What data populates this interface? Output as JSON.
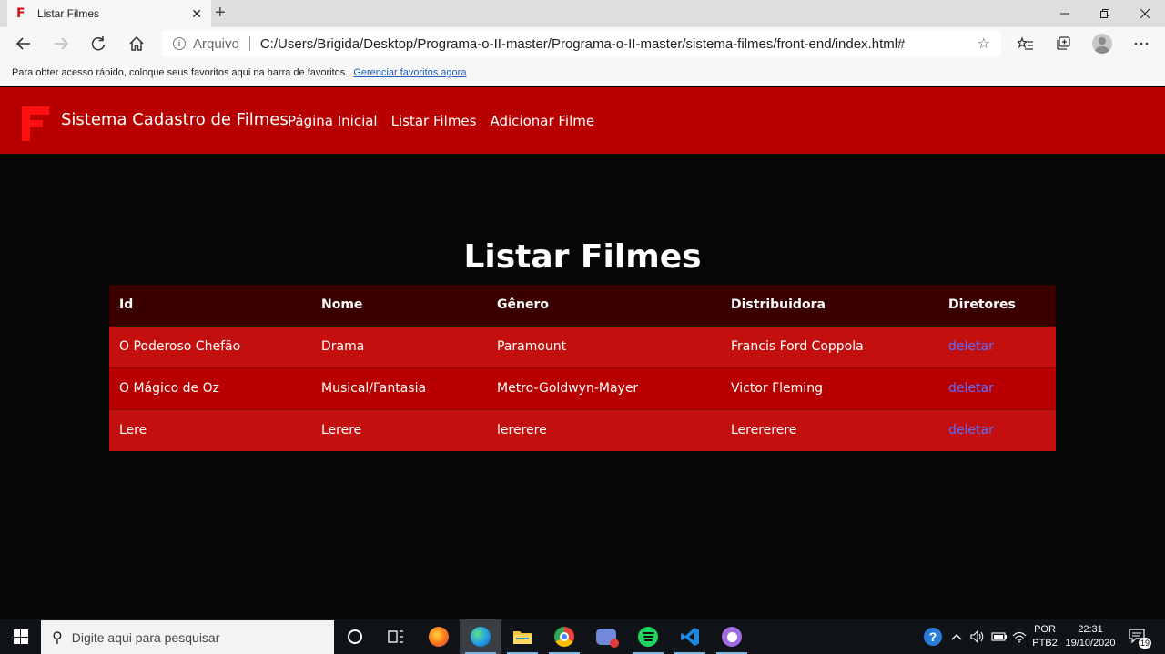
{
  "browser": {
    "tab_title": "Listar Filmes",
    "tab_favicon": "F",
    "close_tab": "✕",
    "new_tab": "+",
    "origin_label": "Arquivo",
    "url": "C:/Users/Brigida/Desktop/Programa-o-II-master/Programa-o-II-master/sistema-filmes/front-end/index.html#",
    "favorites_message": "Para obter acesso rápido, coloque seus favoritos aqui na barra de favoritos.",
    "favorites_link": "Gerenciar favoritos agora",
    "icons": [
      "back-icon",
      "forward-icon",
      "refresh-icon",
      "home-icon",
      "info-icon",
      "star-icon",
      "favorites-icon",
      "collections-icon",
      "profile-icon",
      "more-icon",
      "minimize-icon",
      "maximize-icon",
      "close-icon"
    ]
  },
  "site": {
    "logo": "F",
    "brand": "Sistema Cadastro de Filmes",
    "nav": [
      "Página Inicial",
      "Listar Filmes",
      "Adicionar Filme"
    ],
    "colors": {
      "header": "#b80000",
      "table_head": "#3a0000",
      "link": "#5a6dff"
    }
  },
  "main": {
    "title": "Listar Filmes",
    "columns": [
      "Id",
      "Nome",
      "Gênero",
      "Distribuidora",
      "Diretores"
    ],
    "rows": [
      [
        "O Poderoso Chefão",
        "Drama",
        "Paramount",
        "Francis Ford Coppola",
        "deletar"
      ],
      [
        "O Mágico de Oz",
        "Musical/Fantasia",
        "Metro-Goldwyn-Mayer",
        "Victor Fleming",
        "deletar"
      ],
      [
        "Lere",
        "Lerere",
        "lererere",
        "Lerererere",
        "deletar"
      ]
    ]
  },
  "taskbar": {
    "search_placeholder": "Digite aqui para pesquisar",
    "language": "POR",
    "layout": "PTB2",
    "time": "22:31",
    "date": "19/10/2020",
    "notifications": "19"
  }
}
